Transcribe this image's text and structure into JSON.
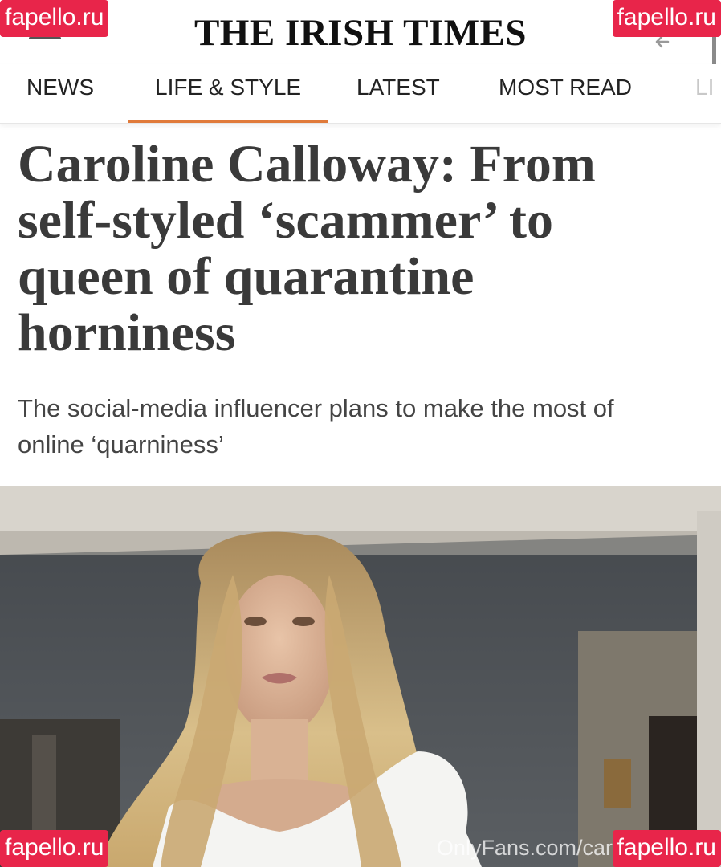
{
  "header": {
    "masthead": "THE IRISH TIMES"
  },
  "nav": {
    "tabs": [
      {
        "label": "NEWS",
        "active": false
      },
      {
        "label": "LIFE & STYLE",
        "active": true
      },
      {
        "label": "LATEST",
        "active": false
      },
      {
        "label": "MOST READ",
        "active": false
      },
      {
        "label": "LI",
        "active": false
      }
    ]
  },
  "article": {
    "headline_lines": [
      "Caroline Calloway: From",
      "self-styled ‘scammer’ to",
      "queen of quarantine",
      "horniness"
    ],
    "standfirst_lines": [
      "The social-media influencer plans to make the most of",
      "online ‘quarniness’"
    ],
    "photo_credit": "OnlyFans.com/caro"
  },
  "watermarks": {
    "text": "fapello.ru"
  },
  "colors": {
    "accent": "#e07a3a",
    "watermark_bg": "#e8254a"
  }
}
